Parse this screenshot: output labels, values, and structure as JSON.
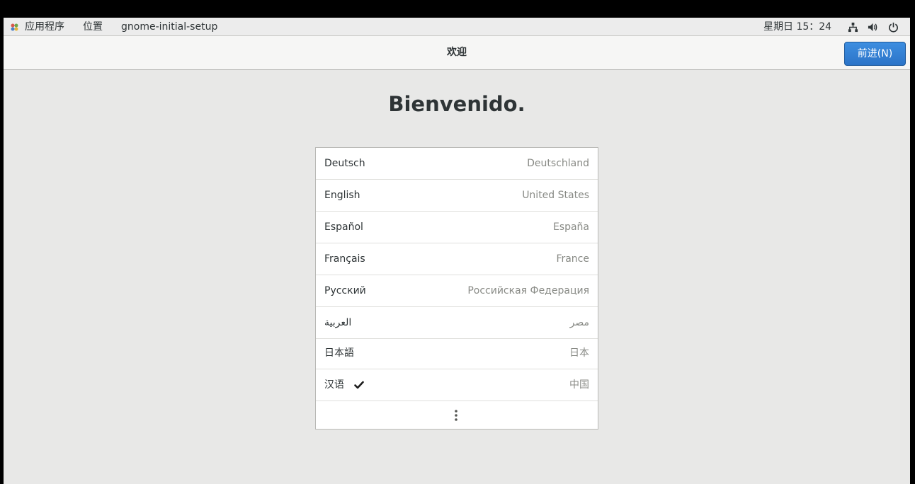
{
  "top_panel": {
    "apps_menu": "应用程序",
    "places_menu": "位置",
    "app_name": "gnome-initial-setup",
    "clock": "星期日 15：24"
  },
  "header": {
    "title": "欢迎",
    "next_button": "前进(N)"
  },
  "welcome_title": "Bienvenido.",
  "languages": [
    {
      "name": "Deutsch",
      "region": "Deutschland"
    },
    {
      "name": "English",
      "region": "United States"
    },
    {
      "name": "Español",
      "region": "España"
    },
    {
      "name": "Français",
      "region": "France"
    },
    {
      "name": "Русский",
      "region": "Российская Федерация"
    },
    {
      "name": "العربية",
      "region": "مصر"
    },
    {
      "name": "日本語",
      "region": "日本"
    },
    {
      "name": "汉语",
      "region": "中国",
      "selected": true
    }
  ],
  "icons": {
    "apps": "apps-icon",
    "network": "network-icon",
    "volume": "volume-icon",
    "power": "power-icon",
    "selected": "check-icon",
    "more": "more-vertical-icon"
  },
  "colors": {
    "accent": "#3584e4",
    "background": "#e8e8e7"
  }
}
